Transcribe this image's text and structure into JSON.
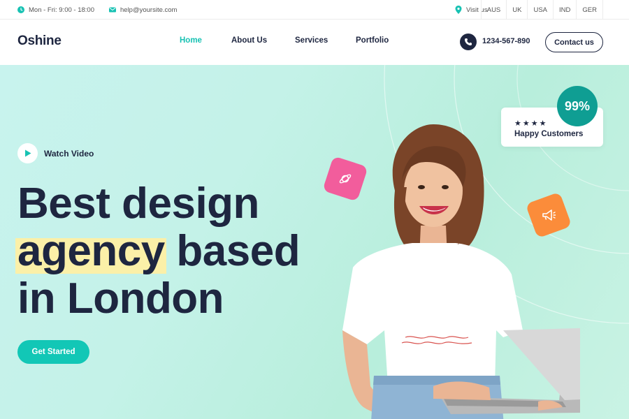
{
  "topbar": {
    "hours": "Mon - Fri: 9:00 - 18:00",
    "email": "help@yoursite.com",
    "visit": "Visit us",
    "languages": [
      "AUS",
      "UK",
      "USA",
      "IND",
      "GER"
    ]
  },
  "header": {
    "logo": "Oshine",
    "nav": [
      {
        "label": "Home",
        "active": true
      },
      {
        "label": "About Us",
        "active": false
      },
      {
        "label": "Services",
        "active": false
      },
      {
        "label": "Portfolio",
        "active": false
      }
    ],
    "phone": "1234-567-890",
    "contact_label": "Contact us"
  },
  "hero": {
    "watch_label": "Watch Video",
    "headline_line1": "Best design",
    "headline_highlight": "agency",
    "headline_line2_rest": " based",
    "headline_line3": "in London",
    "cta_label": "Get Started",
    "rating": {
      "stars": "★★★★",
      "label": "Happy Customers",
      "percent": "99%"
    }
  },
  "colors": {
    "accent": "#12c7b6",
    "dark": "#1e2640",
    "highlight": "#fbf0a8",
    "pink": "#f25d9c",
    "orange": "#fb8c3a",
    "badge_teal": "#0f9e93"
  },
  "icons": [
    "clock-icon",
    "mail-icon",
    "location-pin-icon",
    "phone-icon",
    "play-icon",
    "planet-icon",
    "megaphone-icon"
  ]
}
